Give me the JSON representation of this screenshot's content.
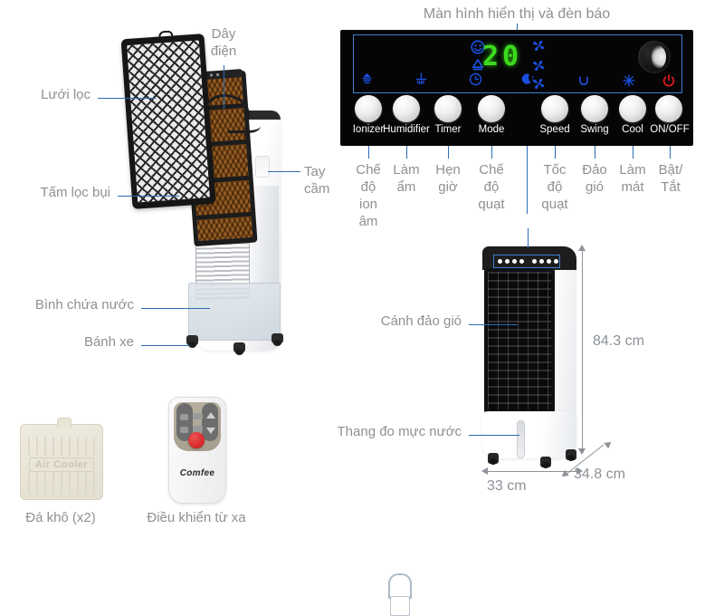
{
  "meta": {
    "product": "Comfee Air Cooler",
    "language": "vi"
  },
  "panel_section": {
    "title": "Màn hình hiển thị và đèn báo",
    "display": {
      "digits": "20",
      "digit_color": "#3cdb1e",
      "indicator_color": "#1b4fe0",
      "power_indicator_color": "#e01b1b",
      "indicators_top": [
        "ion-smiley-icon",
        "humidity-drop-icon",
        "fan-speed-high-icon",
        "fan-speed-mid-icon"
      ],
      "indicators_bottom": [
        "ionizer-icon",
        "humidifier-icon",
        "timer-clock-icon",
        "sleep-moon-icon",
        "fan-speed-low-icon",
        "swing-arc-icon",
        "snowflake-cool-icon",
        "power-icon"
      ],
      "dial": "moon-dial"
    },
    "buttons": [
      {
        "label": "Ionizer",
        "vi": "Chế\\nđộ\\nion\\nâm"
      },
      {
        "label": "Humidifier",
        "vi": "Làm\\nẩm"
      },
      {
        "label": "Timer",
        "vi": "Hẹn\\ngiờ"
      },
      {
        "label": "Mode",
        "vi": "Chế\\nđộ\\nquạt"
      },
      {
        "label": "Speed",
        "vi": "Tốc\\nđộ\\nquạt"
      },
      {
        "label": "Swing",
        "vi": "Đảo\\ngió"
      },
      {
        "label": "Cool",
        "vi": "Làm\\nmát"
      },
      {
        "label": "ON/OFF",
        "vi": "Bật/\\nTắt"
      }
    ]
  },
  "callouts": {
    "mesh_filter": "Lưới lọc",
    "dust_filter": "Tấm lọc bụi",
    "power_cord": "Dây\nđiện",
    "handle": "Tay\ncầm",
    "water_tank": "Bình chứa nước",
    "wheels": "Bánh xe",
    "swing_blade": "Cánh đảo gió",
    "water_gauge": "Thang đo mực nước"
  },
  "accessories": [
    {
      "name": "Đá khô (x2)",
      "embossed_text": "Air Cooler"
    },
    {
      "name": "Điều khiển từ xa",
      "brand": "Comfee"
    }
  ],
  "dimensions": {
    "height": "84.3 cm",
    "width": "33 cm",
    "depth": "34.8 cm",
    "line_color": "#8d9298"
  },
  "colors": {
    "leader_line": "#2d6cb3",
    "label_text": "#909090",
    "panel_background": "#050505"
  }
}
